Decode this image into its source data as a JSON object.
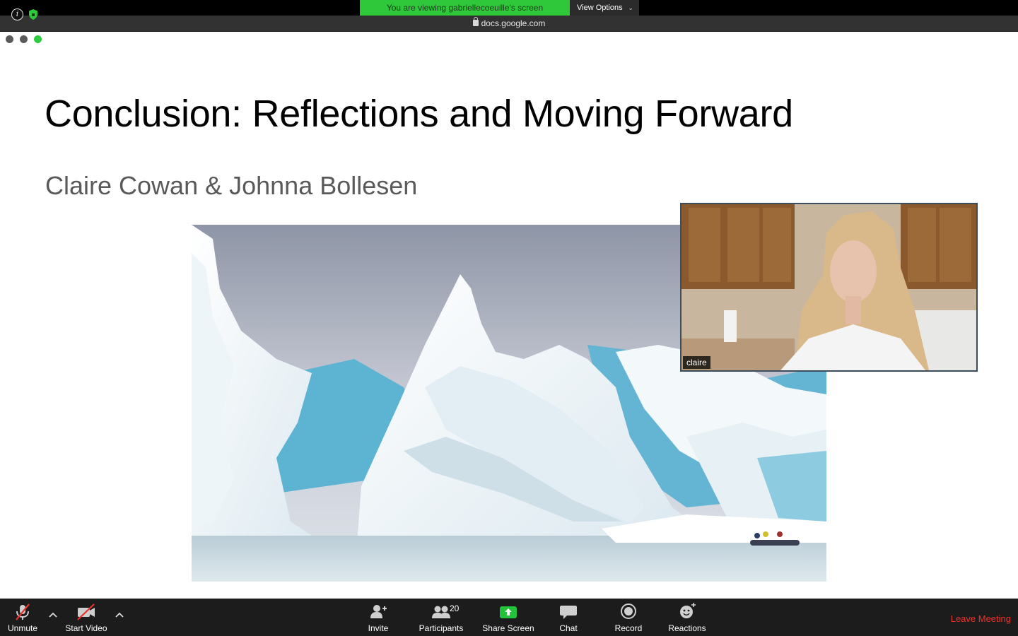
{
  "banner": {
    "viewing_text": "You are viewing gabriellecoeuille's screen",
    "view_options_label": "View Options"
  },
  "browser": {
    "url": "docs.google.com"
  },
  "slide": {
    "title": "Conclusion: Reflections and Moving Forward",
    "subtitle": "Claire Cowan & Johnna Bollesen"
  },
  "video": {
    "participant_name": "claire"
  },
  "toolbar": {
    "unmute_label": "Unmute",
    "start_video_label": "Start Video",
    "invite_label": "Invite",
    "participants_label": "Participants",
    "participants_count": "20",
    "share_screen_label": "Share Screen",
    "chat_label": "Chat",
    "record_label": "Record",
    "reactions_label": "Reactions",
    "leave_label": "Leave Meeting"
  },
  "colors": {
    "banner_green": "#2fc83a",
    "leave_red": "#e8342d",
    "share_green": "#22c23a",
    "toolbar_bg": "#1c1c1c"
  }
}
